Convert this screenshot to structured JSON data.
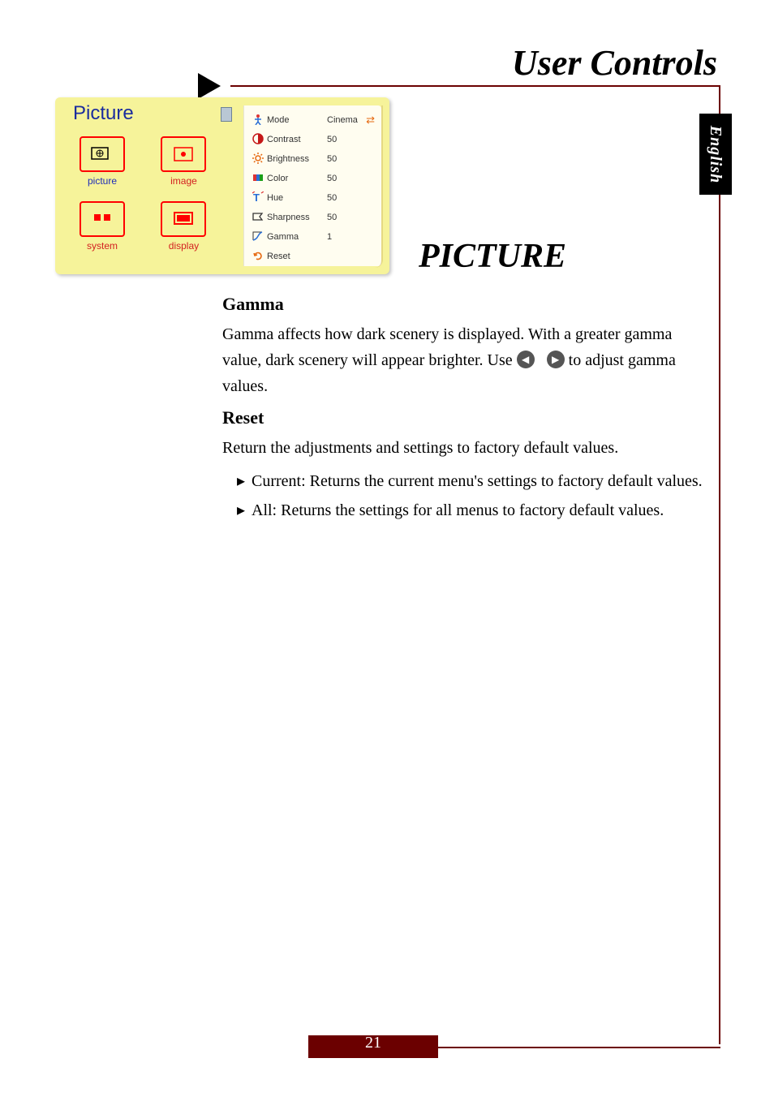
{
  "header": {
    "title": "User Controls",
    "section": "PICTURE",
    "language_tab": "English",
    "page_number": "21"
  },
  "osd": {
    "title": "Picture",
    "cells": [
      {
        "label": "picture",
        "selected": true
      },
      {
        "label": "image",
        "selected": false
      },
      {
        "label": "system",
        "selected": false
      },
      {
        "label": "display",
        "selected": false
      }
    ],
    "rows": [
      {
        "icon": "person-icon",
        "label": "Mode",
        "value": "Cinema",
        "swap": true
      },
      {
        "icon": "contrast-icon",
        "label": "Contrast",
        "value": "50"
      },
      {
        "icon": "brightness-icon",
        "label": "Brightness",
        "value": "50"
      },
      {
        "icon": "color-icon",
        "label": "Color",
        "value": "50"
      },
      {
        "icon": "hue-icon",
        "label": "Hue",
        "value": "50"
      },
      {
        "icon": "sharpness-icon",
        "label": "Sharpness",
        "value": "50"
      },
      {
        "icon": "gamma-icon",
        "label": "Gamma",
        "value": "1"
      },
      {
        "icon": "reset-icon",
        "label": "Reset",
        "value": ""
      }
    ]
  },
  "body": {
    "gamma_heading": "Gamma",
    "gamma_text_a": "Gamma affects how dark scenery is displayed. With a greater gamma value, dark scenery will appear brighter. Use ",
    "gamma_text_b": " to adjust gamma values.",
    "reset_heading": "Reset",
    "reset_text": "Return the adjustments and settings to factory default values.",
    "reset_bullets": [
      "Current: Returns the current menu's settings to factory default values.",
      "All: Returns the settings for all menus to factory default values."
    ]
  }
}
